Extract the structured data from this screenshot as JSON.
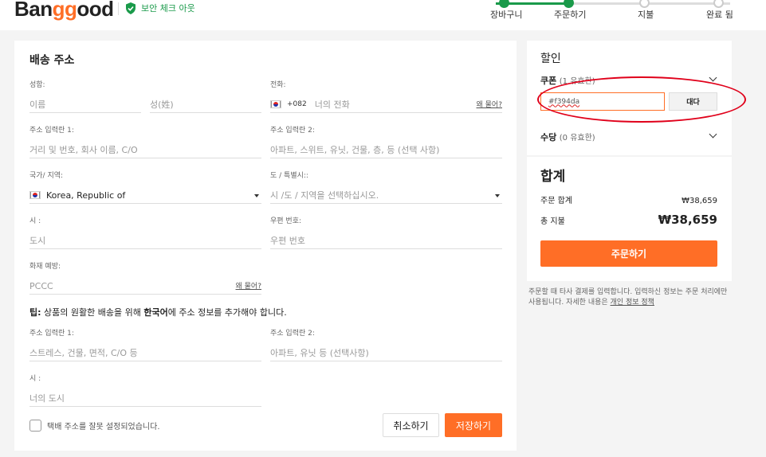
{
  "brand": {
    "logo_pre": "Ban",
    "logo_mid": "gg",
    "logo_post": "ood",
    "secure_text": "보안 체크 아웃"
  },
  "steps": [
    {
      "label": "장바구니",
      "active": true
    },
    {
      "label": "주문하기",
      "active": true
    },
    {
      "label": "지불",
      "active": false
    },
    {
      "label": "완료 됨",
      "active": false
    }
  ],
  "form": {
    "title": "배송 주소",
    "name_label": "성함:",
    "first_placeholder": "이름",
    "last_placeholder": "성(姓)",
    "phone_label": "전화:",
    "phone_code": "+082",
    "phone_placeholder": "너의 전화",
    "why_link": "왜 물어?",
    "addr1_label": "주소 입력란 1:",
    "addr1_placeholder": "거리 및 번호, 회사 이름, C/O",
    "addr2_label": "주소 입력란 2:",
    "addr2_placeholder": "아파트, 스위트, 유닛, 건물, 층, 등 (선택 사항)",
    "country_label": "국가/ 지역:",
    "country_value": "Korea, Republic of",
    "state_label": "도 / 특별시::",
    "state_placeholder": "시 /도 / 지역을 선택하십시오.",
    "city_label": "시 :",
    "city_placeholder": "도시",
    "zip_label": "우편 번호:",
    "zip_placeholder": "우편 번호",
    "pccc_label": "화재 예방:",
    "pccc_placeholder": "PCCC",
    "pccc_why": "왜 물어?",
    "tip_prefix": "팁:",
    "tip_text": " 상품의 원활한 배송을 위해 ",
    "tip_bold": "한국어",
    "tip_suffix": "에 주소 정보를 추가해야 합니다.",
    "kr_addr1_label": "주소 입력란 1:",
    "kr_addr1_placeholder": "스트레스, 건물, 면적, C/O 등",
    "kr_addr2_label": "주소 입력란 2:",
    "kr_addr2_placeholder": "아파트, 유닛 등 (선택사항)",
    "kr_city_label": "시 :",
    "kr_city_placeholder": "너의 도시",
    "checkbox_label": "택배 주소를 잘못 설정되었습니다.",
    "cancel": "취소하기",
    "save": "저장하기"
  },
  "discount": {
    "title": "할인",
    "coupon_label": "쿠폰",
    "coupon_count": "(1 유효한)",
    "coupon_value": "#f394da",
    "apply": "대다",
    "points_label": "수당",
    "points_count": "(0 유효한)"
  },
  "summary": {
    "title": "합계",
    "subtotal_label": "주문 합계",
    "subtotal_value": "₩38,659",
    "total_label": "총 지불",
    "total_value": "₩38,659",
    "order_button": "주문하기"
  },
  "notice": {
    "text": "주문할 때 타사 결제를 입력합니다. 입력하신 정보는 주문 처리에만 사용됩니다. 자세한 내용은 ",
    "link": "개인 정보 정책"
  },
  "colors": {
    "accent": "#ff6e26",
    "success": "#1a9a4a",
    "highlight": "#e0001a"
  }
}
